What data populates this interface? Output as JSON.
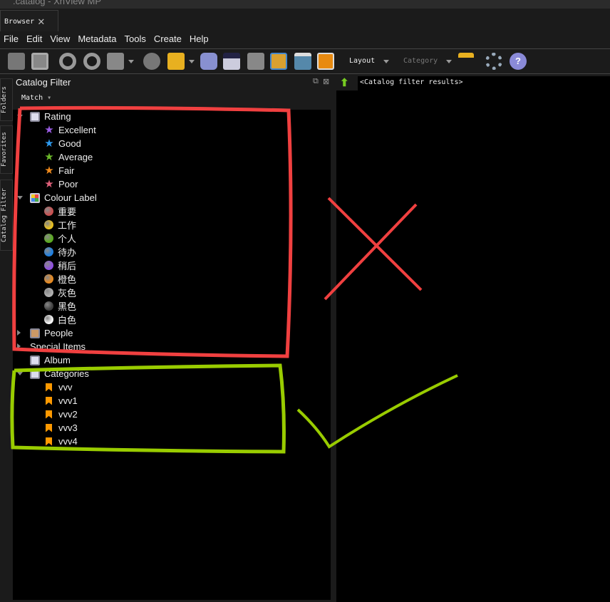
{
  "window": {
    "title": ".catalog - XnView MP"
  },
  "tabs": [
    {
      "label": "Browser"
    }
  ],
  "menu": [
    "File",
    "Edit",
    "View",
    "Metadata",
    "Tools",
    "Create",
    "Help"
  ],
  "toolbar": {
    "layout_label": "Layout",
    "category_label": "Category"
  },
  "side_tabs": [
    "Folders",
    "Favorites",
    "Catalog Filter"
  ],
  "panel": {
    "title": "Catalog Filter",
    "match_label": "Match"
  },
  "tree": {
    "rating": {
      "label": "Rating",
      "items": [
        {
          "label": "Excellent",
          "color": "#9b5de5"
        },
        {
          "label": "Good",
          "color": "#2e9bf0"
        },
        {
          "label": "Average",
          "color": "#6bb82a"
        },
        {
          "label": "Fair",
          "color": "#f08a1c"
        },
        {
          "label": "Poor",
          "color": "#e0607a"
        }
      ]
    },
    "colour": {
      "label": "Colour Label",
      "items": [
        {
          "label": "重要",
          "color": "#c85050"
        },
        {
          "label": "工作",
          "color": "#e8c020"
        },
        {
          "label": "个人",
          "color": "#5aaa20"
        },
        {
          "label": "待办",
          "color": "#2080e0"
        },
        {
          "label": "稍后",
          "color": "#9050e0"
        },
        {
          "label": "橙色",
          "color": "#e88a20"
        },
        {
          "label": "灰色",
          "color": "#b0b0b0"
        },
        {
          "label": "黑色",
          "color": "#404040"
        },
        {
          "label": "白色",
          "color": "#f5f5f5"
        }
      ]
    },
    "people": "People",
    "special": "Special Items",
    "album": "Album",
    "categories": {
      "label": "Categories",
      "items": [
        "vvv",
        "vvv1",
        "vvv2",
        "vvv3",
        "vvv4"
      ]
    }
  },
  "browser": {
    "path": "<Catalog filter results>"
  }
}
